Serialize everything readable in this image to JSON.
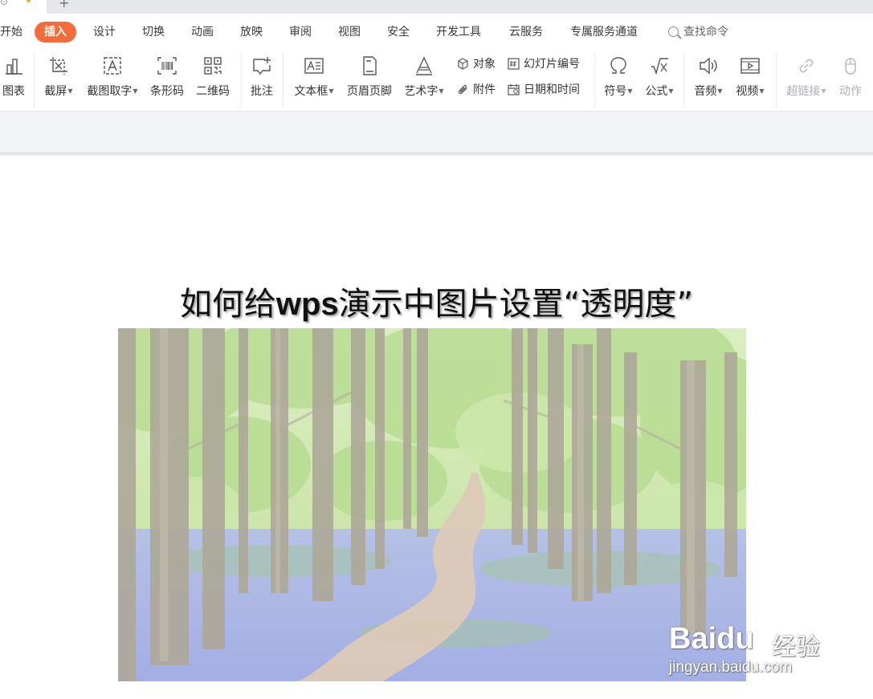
{
  "menu": {
    "tabs": [
      {
        "label": "开始"
      },
      {
        "label": "插入"
      },
      {
        "label": "设计"
      },
      {
        "label": "切换"
      },
      {
        "label": "动画"
      },
      {
        "label": "放映"
      },
      {
        "label": "审阅"
      },
      {
        "label": "视图"
      },
      {
        "label": "安全"
      },
      {
        "label": "开发工具"
      },
      {
        "label": "云服务"
      },
      {
        "label": "专属服务通道"
      }
    ],
    "active_tab": "插入",
    "search_label": "查找命令"
  },
  "ribbon": {
    "chart": "图表",
    "screenshot": "截屏",
    "ocr": "截图取字",
    "barcode": "条形码",
    "qrcode": "二维码",
    "comment": "批注",
    "textbox": "文本框",
    "header_footer": "页眉页脚",
    "wordart": "艺术字",
    "object": "对象",
    "attachment": "附件",
    "slide_number": "幻灯片编号",
    "date_time": "日期和时间",
    "symbol": "符号",
    "formula": "公式",
    "audio": "音频",
    "video": "视频",
    "hyperlink": "超链接",
    "action": "动作"
  },
  "slide": {
    "title_pre": "如何给",
    "title_bold": "wps",
    "title_post": "演示中图片设置“透明度”"
  },
  "watermark": {
    "logo": "Bai",
    "logo_tail": "du",
    "cn": "经验",
    "url": "jingyan.baidu.com"
  },
  "colors": {
    "accent": "#f26d3d",
    "ribbon_bg": "#ffffff",
    "band_bg": "#f3f4f6",
    "disabled_text": "#a9adb5"
  }
}
